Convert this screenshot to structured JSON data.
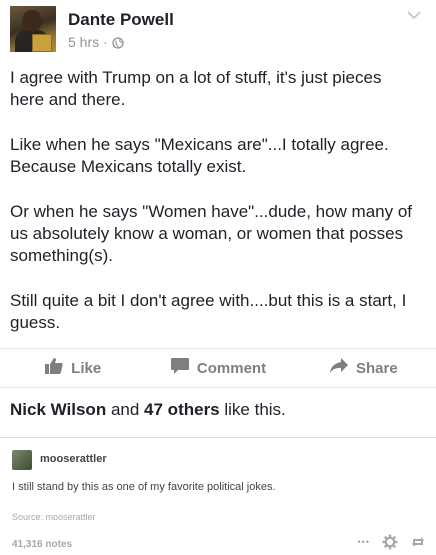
{
  "post": {
    "author": "Dante Powell",
    "time": "5 hrs",
    "separator": "·",
    "paragraphs": [
      "I agree with Trump on a lot of stuff, it's just pieces here and there.",
      "Like when he says \"Mexicans are\"...I totally agree. Because Mexicans totally exist.",
      "Or when he says \"Women have\"...dude, how many of us absolutely know a woman, or women that posses something(s).",
      "Still quite a bit I don't agree with....but this is a start, I guess."
    ]
  },
  "actions": {
    "like_label": "Like",
    "comment_label": "Comment",
    "share_label": "Share"
  },
  "likes": {
    "name": "Nick Wilson",
    "connector": "and",
    "others": "47 others",
    "suffix": "like this."
  },
  "tumblr": {
    "username": "mooserattler",
    "comment": "I still stand by this as one of my favorite political jokes.",
    "source": "Source: mooserattler",
    "notes": "41,316 notes",
    "more_label": "•••"
  },
  "icons": {
    "globe": "globe-icon",
    "chevron": "chevron-down-icon",
    "like": "thumbs-up-icon",
    "comment": "comment-icon",
    "share": "share-arrow-icon",
    "more": "more-icon",
    "settings": "gear-icon",
    "reblog": "reblog-icon"
  },
  "colors": {
    "text_primary": "#1d2129",
    "text_muted": "#90949c",
    "action_gray": "#7f7f7f",
    "tumblr_gray": "#a8a8a8"
  }
}
